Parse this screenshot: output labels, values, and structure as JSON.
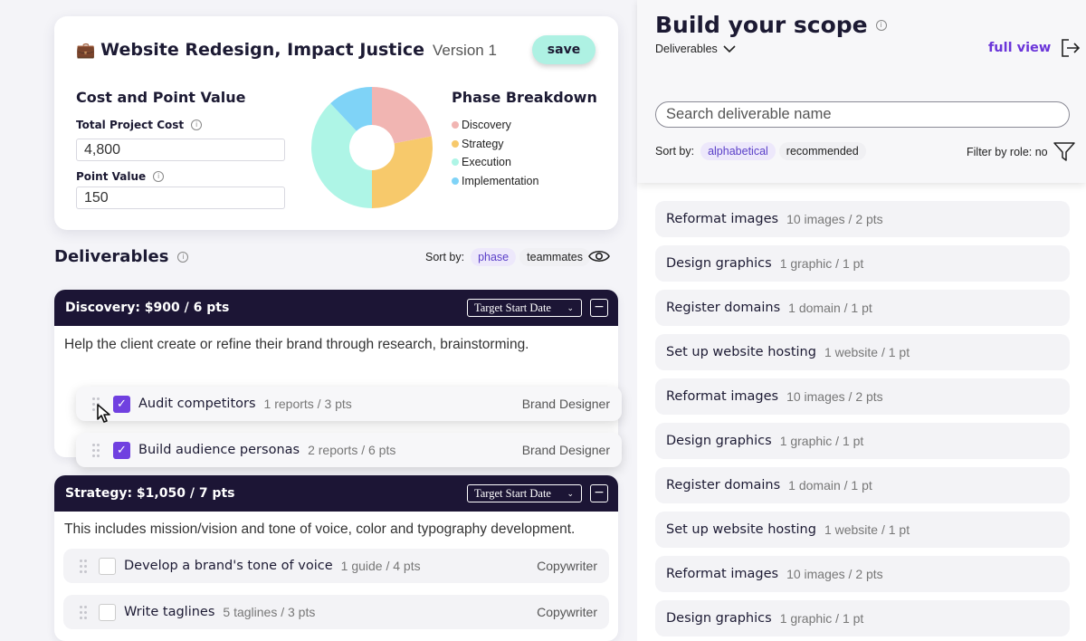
{
  "project": {
    "title": "Website Redesign, Impact Justice",
    "version": "Version 1",
    "save_label": "save"
  },
  "cost": {
    "heading": "Cost and Point Value",
    "total_label": "Total Project Cost",
    "total_value": "4,800",
    "point_label": "Point Value",
    "point_value": "150"
  },
  "phase_breakdown": {
    "heading": "Phase Breakdown",
    "items": [
      {
        "label": "Discovery",
        "color": "#f1b5b2",
        "share": 0.22
      },
      {
        "label": "Strategy",
        "color": "#f7c96b",
        "share": 0.28
      },
      {
        "label": "Execution",
        "color": "#aef5e6",
        "share": 0.38
      },
      {
        "label": "Implementation",
        "color": "#7fd3f7",
        "share": 0.12
      }
    ]
  },
  "deliverables": {
    "heading": "Deliverables",
    "sort_label": "Sort by:",
    "sort_options": [
      "phase",
      "teammates"
    ],
    "phases": [
      {
        "title": "Discovery: $900 / 6 pts",
        "date_label": "Target Start Date",
        "description": "Help the client create or refine their brand through research, brainstorming.",
        "tasks": [
          {
            "name": "Audit competitors",
            "meta": "1 reports / 3 pts",
            "role": "Brand Designer",
            "checked": true
          },
          {
            "name": "Build audience personas",
            "meta": "2 reports / 6 pts",
            "role": "Brand Designer",
            "checked": true
          }
        ]
      },
      {
        "title": "Strategy: $1,050 / 7 pts",
        "date_label": "Target Start Date",
        "description": "This includes mission/vision and tone of voice, color and typography development.",
        "tasks": [
          {
            "name": "Develop a brand's tone of voice",
            "meta": "1 guide / 4 pts",
            "role": "Copywriter",
            "checked": false
          },
          {
            "name": "Write taglines",
            "meta": "5 taglines / 3 pts",
            "role": "Copywriter",
            "checked": false
          }
        ]
      }
    ]
  },
  "scope": {
    "title": "Build your scope",
    "subtitle": "Deliverables",
    "full_view": "full view",
    "search_placeholder": "Search deliverable name",
    "sort_label": "Sort by:",
    "sort_options": [
      "alphabetical",
      "recommended"
    ],
    "filter_label": "Filter by role: no",
    "items": [
      {
        "name": "Reformat images",
        "meta": "10 images / 2 pts"
      },
      {
        "name": "Design graphics",
        "meta": "1 graphic / 1 pt"
      },
      {
        "name": "Register domains",
        "meta": "1 domain / 1 pt"
      },
      {
        "name": "Set up website hosting",
        "meta": "1 website / 1 pt"
      },
      {
        "name": "Reformat images",
        "meta": "10 images / 2 pts"
      },
      {
        "name": "Design graphics",
        "meta": "1 graphic / 1 pt"
      },
      {
        "name": "Register domains",
        "meta": "1 domain / 1 pt"
      },
      {
        "name": "Set up website hosting",
        "meta": "1 website / 1 pt"
      },
      {
        "name": "Reformat images",
        "meta": "10 images / 2 pts"
      },
      {
        "name": "Design graphics",
        "meta": "1 graphic / 1 pt"
      }
    ]
  },
  "icons": {
    "briefcase": "briefcase-icon",
    "info": "info-icon",
    "eye": "eye-icon",
    "drag": "drag-handle-icon",
    "exit": "exit-icon",
    "filter": "filter-icon"
  }
}
